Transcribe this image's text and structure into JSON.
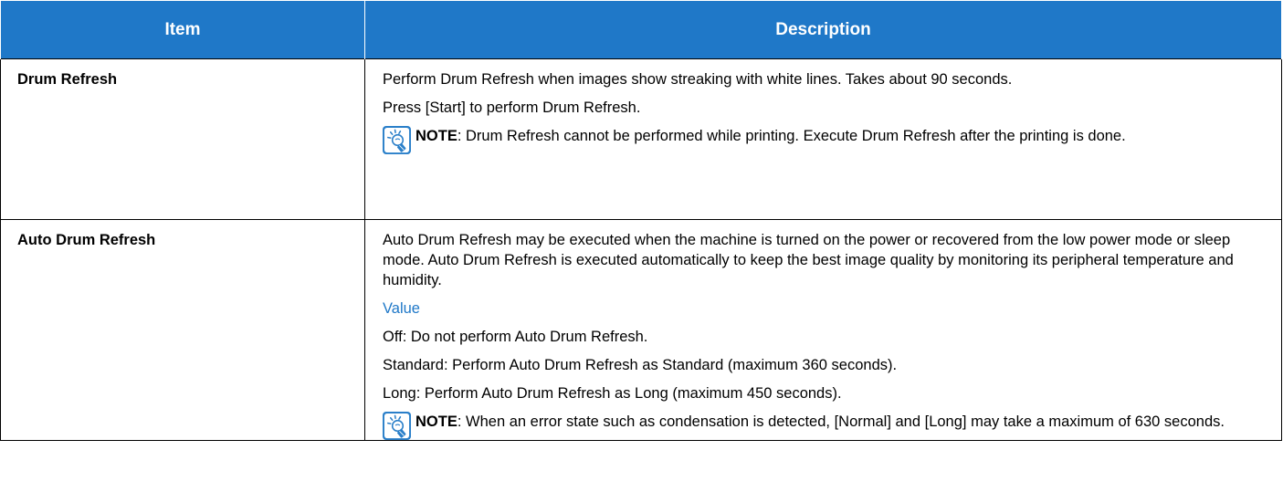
{
  "table": {
    "headers": {
      "item": "Item",
      "description": "Description"
    },
    "rows": [
      {
        "item": "Drum Refresh",
        "paragraphs": [
          "Perform Drum Refresh when images show streaking with white lines. Takes about 90 seconds.",
          "Press [Start] to perform Drum Refresh."
        ],
        "note": {
          "label": "NOTE",
          "text": ": Drum Refresh cannot be performed while printing. Execute Drum Refresh after the printing is done."
        }
      },
      {
        "item": "Auto Drum Refresh",
        "intro": "Auto Drum Refresh may be executed when the machine is turned on the power or recovered from the low power mode or sleep mode. Auto Drum Refresh is executed automatically to keep the best image quality by monitoring its peripheral temperature and humidity.",
        "value_heading": "Value",
        "values": [
          "Off: Do not perform Auto Drum Refresh.",
          "Standard: Perform Auto Drum Refresh as Standard (maximum 360 seconds).",
          "Long: Perform Auto Drum Refresh as Long (maximum 450 seconds)."
        ],
        "note": {
          "label": "NOTE",
          "text": ": When an error state such as condensation is detected, [Normal] and [Long] may take a maximum of 630 seconds."
        }
      }
    ]
  },
  "icons": {
    "note": "note-lightbulb-icon"
  },
  "colors": {
    "header_bg": "#1f78c8",
    "value_heading": "#1f78c8",
    "note_icon": "#2a7fc9"
  }
}
